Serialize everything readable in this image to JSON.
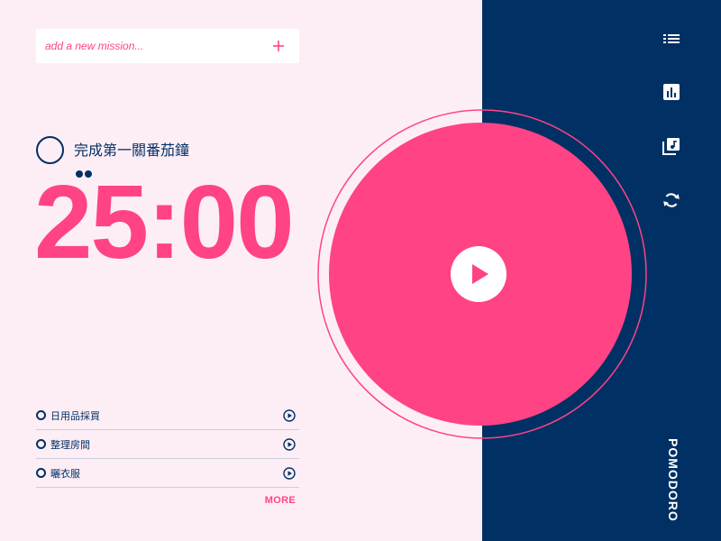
{
  "mission": {
    "placeholder": "add a new mission...",
    "add_icon": "plus-icon"
  },
  "current_task": {
    "title": "完成第一關番茄鐘",
    "completed_pomodoros": 2
  },
  "timer": {
    "display": "25:00",
    "progress": 0.0
  },
  "tasks": [
    {
      "label": "日用品採買",
      "icon": "play-circle-icon"
    },
    {
      "label": "整理房間",
      "icon": "play-circle-icon"
    },
    {
      "label": "曬衣服",
      "icon": "play-circle-icon"
    }
  ],
  "more_label": "MORE",
  "nav": {
    "items": [
      {
        "icon": "list-icon"
      },
      {
        "icon": "bar-chart-icon"
      },
      {
        "icon": "music-library-icon"
      },
      {
        "icon": "sync-icon"
      }
    ],
    "brand": "POMODORO"
  },
  "colors": {
    "pink": "#ff4384",
    "navy": "#013064",
    "background": "#fdeef5"
  }
}
